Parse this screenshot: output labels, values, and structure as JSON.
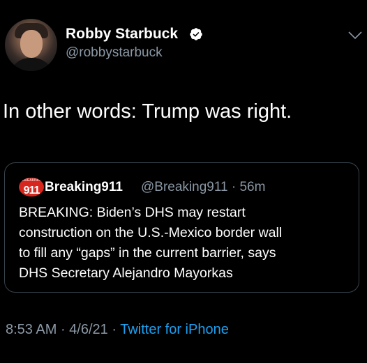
{
  "author": {
    "display_name": "Robby Starbuck",
    "handle": "@robbystarbuck",
    "verified": true
  },
  "tweet": {
    "text": "In other words: Trump was right."
  },
  "quoted_tweet": {
    "logo_text": "911",
    "logo_caption": "BREAKING",
    "display_name": "Breaking911",
    "handle_and_time": "@Breaking911 · 56m",
    "body_lines": [
      "BREAKING: Biden’s DHS may restart",
      "construction on the U.S.-Mexico border wall",
      "to fill any “gaps” in the current barrier, says",
      "DHS Secretary Alejandro Mayorkas"
    ]
  },
  "footer": {
    "time": "8:53 AM",
    "separator1": " · ",
    "date": "4/6/21",
    "separator2": " · ",
    "source": "Twitter for iPhone"
  },
  "colors": {
    "background": "#000000",
    "text": "#ffffff",
    "secondary_text": "#8b98a5",
    "link": "#1da1f2",
    "border": "#38444d",
    "logo_red": "#d7261e"
  },
  "icons": {
    "verified": "verified-badge-icon",
    "caret": "chevron-down-icon"
  }
}
